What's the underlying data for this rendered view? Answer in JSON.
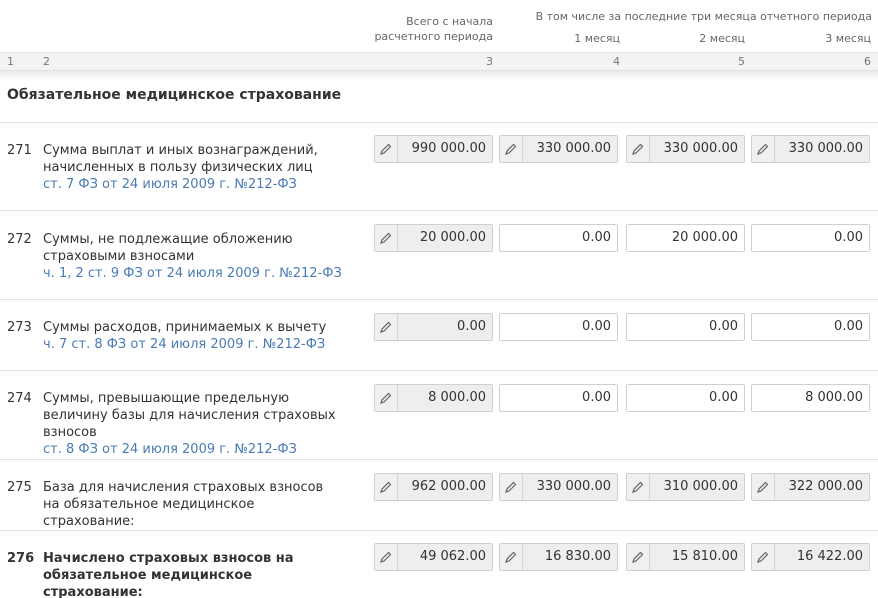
{
  "header": {
    "total_label_1": "Всего с начала",
    "total_label_2": "расчетного периода",
    "group_label": "В том числе за последние три месяца отчетного периода",
    "month1": "1 месяц",
    "month2": "2 месяц",
    "month3": "3 месяц"
  },
  "column_numbers": [
    "1",
    "2",
    "3",
    "4",
    "5",
    "6"
  ],
  "section_title": "Обязательное медицинское страхование",
  "rows": [
    {
      "code": "271",
      "label": "Сумма выплат и иных вознаграждений, начисленных в пользу физических лиц",
      "ref": "ст. 7 ФЗ от 24 июля 2009 г. №212-ФЗ",
      "values": [
        "990 000.00",
        "330 000.00",
        "330 000.00",
        "330 000.00"
      ]
    },
    {
      "code": "272",
      "label": "Суммы, не подлежащие обложению страховыми взносами",
      "ref": "ч. 1, 2 ст. 9 ФЗ от 24 июля 2009 г. №212-ФЗ",
      "values": [
        "20 000.00",
        "0.00",
        "20 000.00",
        "0.00"
      ]
    },
    {
      "code": "273",
      "label": "Суммы расходов, принимаемых к вычету",
      "ref": "ч. 7 ст. 8 ФЗ от 24 июля 2009 г. №212-ФЗ",
      "values": [
        "0.00",
        "0.00",
        "0.00",
        "0.00"
      ]
    },
    {
      "code": "274",
      "label": "Суммы, превышающие предельную величину базы для начисления страховых взносов",
      "ref": "ст. 8 ФЗ от 24 июля 2009 г. №212-ФЗ",
      "values": [
        "8 000.00",
        "0.00",
        "0.00",
        "8 000.00"
      ]
    },
    {
      "code": "275",
      "label": "База для начисления страховых взносов на обязательное медицинское страхование:",
      "ref": "",
      "values": [
        "962 000.00",
        "330 000.00",
        "310 000.00",
        "322 000.00"
      ]
    },
    {
      "code": "276",
      "label": "Начислено страховых взносов на обязательное медицинское страхование:",
      "ref": "",
      "values": [
        "49 062.00",
        "16 830.00",
        "15 810.00",
        "16 422.00"
      ]
    }
  ],
  "icons": {
    "edit": "pencil-icon"
  },
  "colors": {
    "link": "#4a7bb5",
    "calc_field_bg": "#eeeeee",
    "header_strip_bg": "#f3f3f3"
  }
}
